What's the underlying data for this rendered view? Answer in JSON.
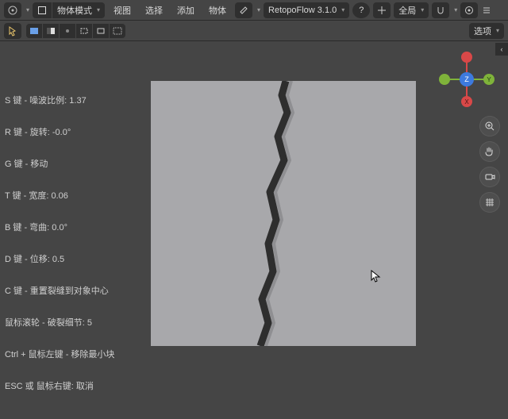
{
  "topbar": {
    "mode_label": "物体模式",
    "menu_view": "视图",
    "menu_select": "选择",
    "menu_add": "添加",
    "menu_object": "物体",
    "addon": "RetopoFlow 3.1.0",
    "global": "全局",
    "options": "选项"
  },
  "info": {
    "s_key": "S 键 - 噪波比例:  1.37",
    "r_key": "R 键 - 旋转:  -0.0°",
    "g_key": "G 键 - 移动",
    "t_key": "T 键 - 宽度:  0.06",
    "b_key": "B 键 - 弯曲:  0.0°",
    "d_key": "D 键 - 位移:  0.5",
    "c_key": "C 键 - 重置裂缝到对象中心",
    "wheel": "鼠标滚轮 - 破裂细节:  5",
    "ctrl_lmb": "Ctrl + 鼠标左键 - 移除最小块",
    "esc_rmb": "ESC 或 鼠标右键: 取消"
  },
  "gizmo_axes": {
    "x": "X",
    "y": "Y",
    "z": "Z"
  },
  "colors": {
    "x": "#d94848",
    "y": "#7fb33a",
    "z": "#3d7adf"
  }
}
